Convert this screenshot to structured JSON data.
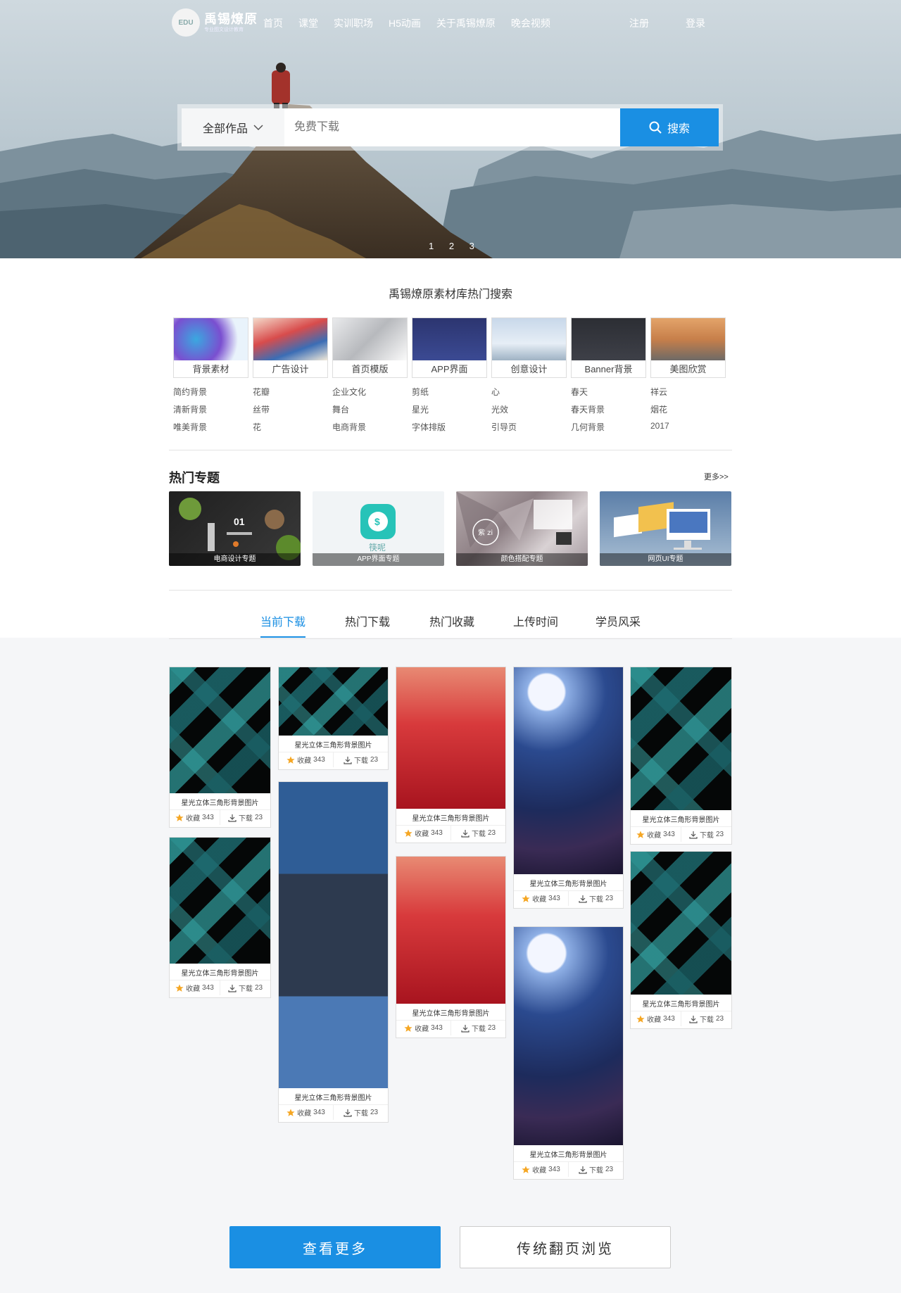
{
  "logo": {
    "name": "禹锡燎原",
    "subtitle": "专业图文设计教育",
    "mark": "EDU"
  },
  "nav": {
    "items": [
      "首页",
      "课堂",
      "实训职场",
      "H5动画",
      "关于禹锡燎原",
      "晚会视频"
    ],
    "register": "注册",
    "login": "登录"
  },
  "search": {
    "scope": "全部作品",
    "placeholder": "免费下载",
    "button": "搜索"
  },
  "carousel": {
    "dots": "1 2 3"
  },
  "hot_search": {
    "title": "禹锡燎原素材库热门搜索",
    "categories": [
      "背景素材",
      "广告设计",
      "首页模版",
      "APP界面",
      "创意设计",
      "Banner背景",
      "美图欣赏"
    ],
    "tags": [
      [
        "简约背景",
        "花瓣",
        "企业文化",
        "剪纸",
        "心",
        "春天",
        "祥云"
      ],
      [
        "清新背景",
        "丝带",
        "舞台",
        "星光",
        "光效",
        "春天背景",
        "烟花"
      ],
      [
        "唯美背景",
        "花",
        "电商背景",
        "字体排版",
        "引导页",
        "几何背景",
        "2017"
      ]
    ]
  },
  "topics": {
    "title": "热门专题",
    "more": "更多>>",
    "items": [
      "电商设计专题",
      "APP界面专题",
      "颜色搭配专题",
      "网页UI专题"
    ],
    "inner_text": [
      "01",
      "筷呢",
      "紫 zi"
    ]
  },
  "tabs": [
    "当前下载",
    "热门下载",
    "热门收藏",
    "上传时间",
    "学员风采"
  ],
  "card": {
    "title": "星光立体三角形背景图片",
    "fav_label": "收藏",
    "fav_count": "343",
    "dl_label": "下载",
    "dl_count": "23"
  },
  "buttons": {
    "more": "查看更多",
    "paging": "传统翻页浏览"
  },
  "colors": {
    "accent": "#1a8fe3",
    "star": "#f5a623"
  }
}
